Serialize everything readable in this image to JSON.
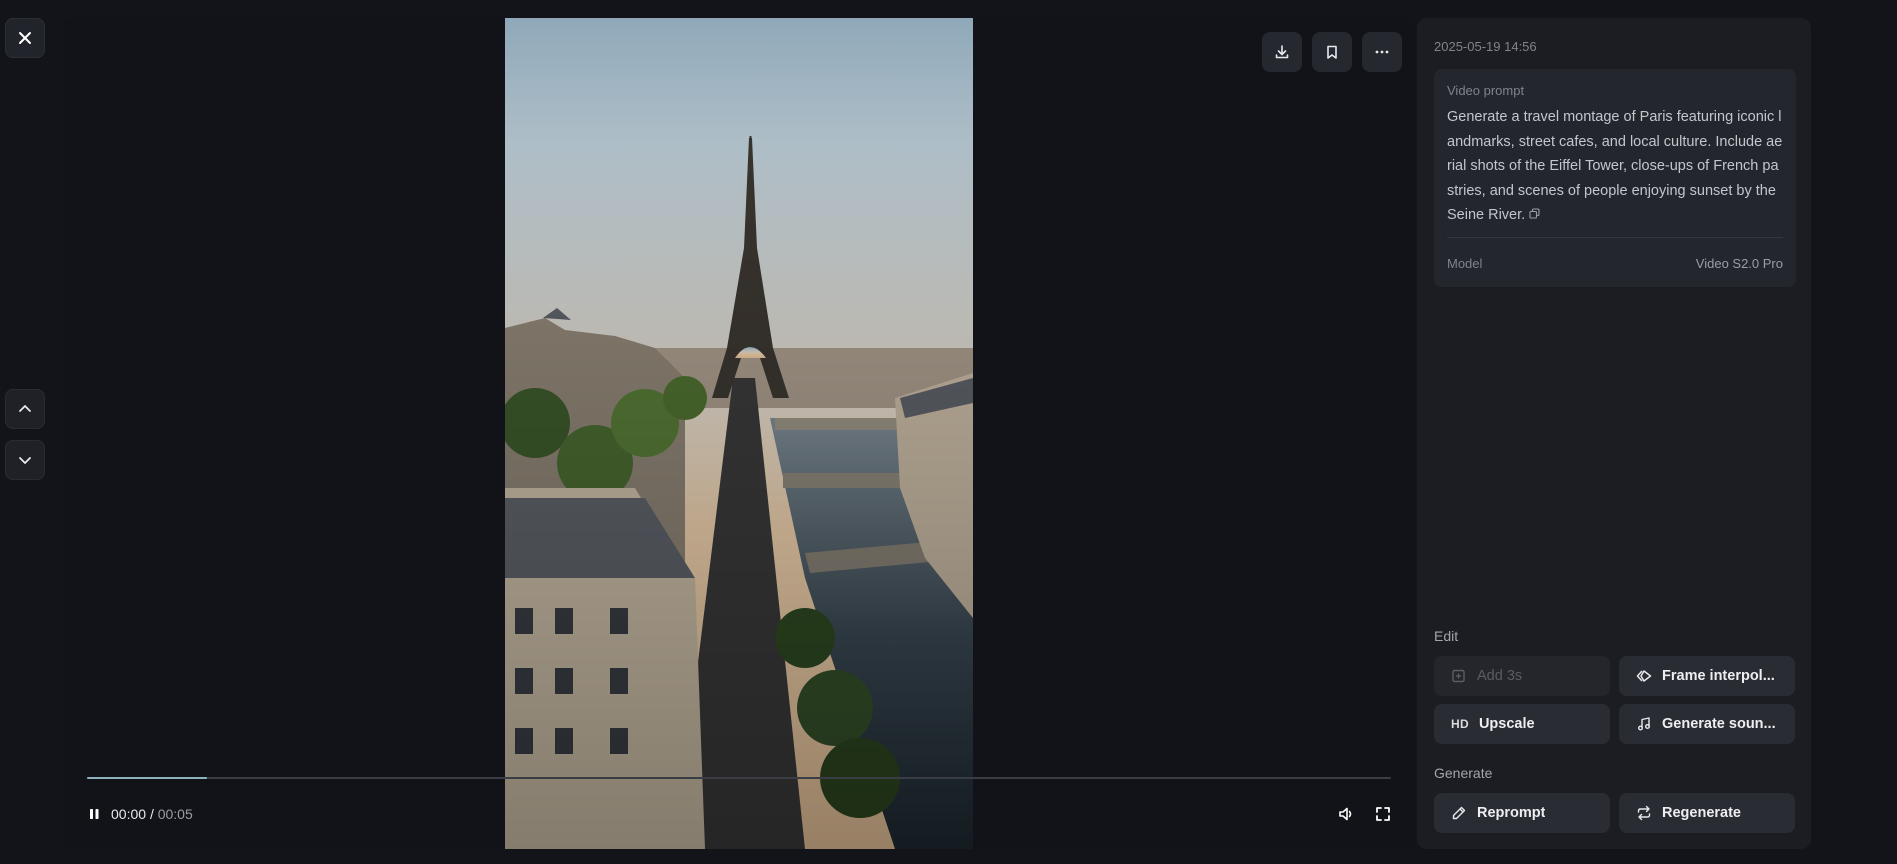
{
  "viewer": {
    "time_current": "00:00",
    "time_separator": "/",
    "time_total": "00:05",
    "progress": 0.092
  },
  "details": {
    "timestamp": "2025-05-19 14:56",
    "prompt_label": "Video prompt",
    "prompt_text": "Generate a travel montage of Paris featuring iconic landmarks, street cafes, and local culture. Include aerial shots of the Eiffel Tower, close-ups of French pastries, and scenes of people enjoying sunset by the Seine River.",
    "model_label": "Model",
    "model_value": "Video S2.0 Pro"
  },
  "edit": {
    "label": "Edit",
    "add": "Add 3s",
    "frame": "Frame interpol...",
    "upscale_icon": "HD",
    "upscale": "Upscale",
    "sound": "Generate soun..."
  },
  "generate": {
    "label": "Generate",
    "reprompt": "Reprompt",
    "regenerate": "Regenerate"
  },
  "colors": {
    "background": "#131419",
    "panel": "#1b1d23",
    "card": "#24262d",
    "button": "#2a2c33",
    "progress": "#8fb3bd"
  },
  "icons": [
    "close-icon",
    "chevron-up-icon",
    "chevron-down-icon",
    "download-icon",
    "bookmark-icon",
    "more-icon",
    "pause-icon",
    "volume-icon",
    "fullscreen-icon",
    "copy-icon",
    "add-clip-icon",
    "frame-interpolation-icon",
    "music-icon",
    "pencil-icon",
    "repeat-icon"
  ]
}
